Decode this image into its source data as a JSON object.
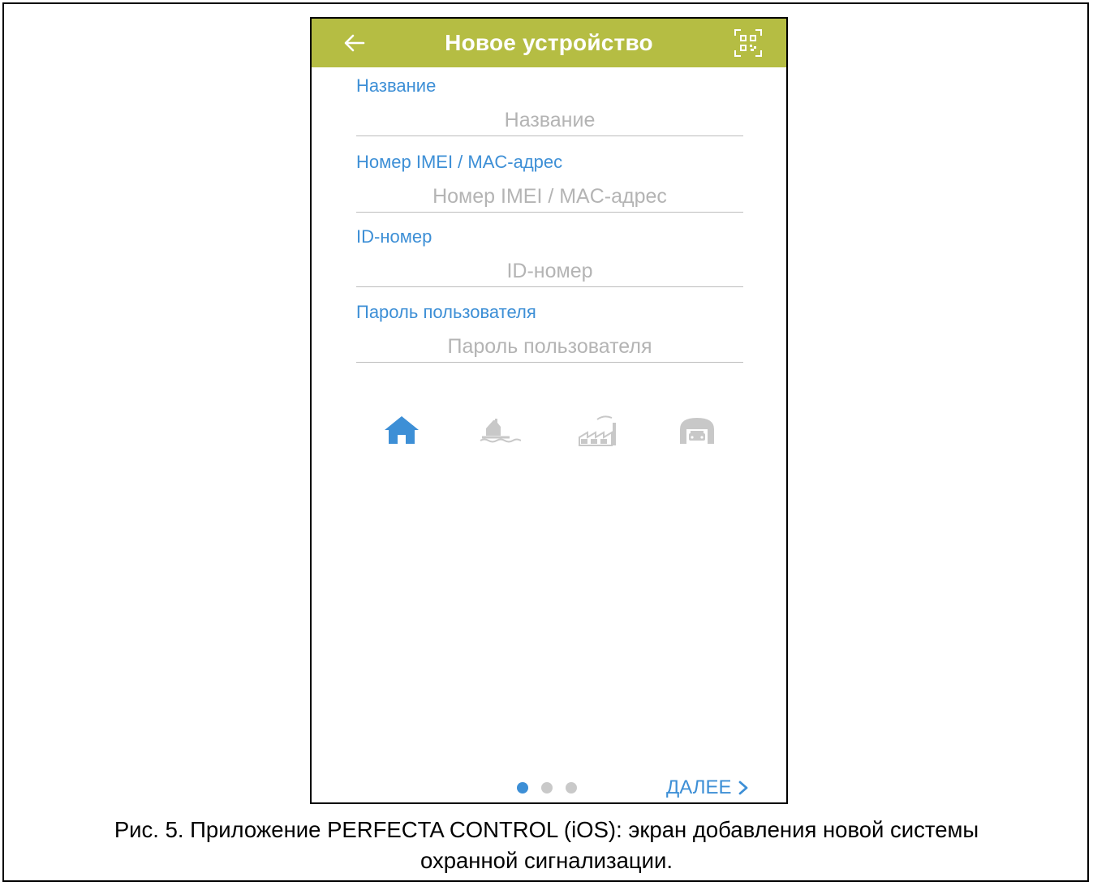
{
  "header": {
    "title": "Новое устройство",
    "back_icon": "arrow-left-icon",
    "qr_icon": "qr-code-scan-icon",
    "accent_color": "#b5bd43"
  },
  "form": {
    "fields": [
      {
        "label": "Название",
        "placeholder": "Название",
        "value": ""
      },
      {
        "label": "Номер IMEI / MAC-адрес",
        "placeholder": "Номер IMEI / MAC-адрес",
        "value": ""
      },
      {
        "label": "ID-номер",
        "placeholder": "ID-номер",
        "value": ""
      },
      {
        "label": "Пароль пользователя",
        "placeholder": "Пароль пользователя",
        "value": ""
      }
    ],
    "label_color": "#3d8fd6"
  },
  "object_types": {
    "selected": "home-icon",
    "icons": [
      "home-icon",
      "lake-house-icon",
      "factory-icon",
      "garage-icon"
    ],
    "active_color": "#3d8fd6",
    "inactive_color": "#c8c8c8"
  },
  "pager": {
    "total": 3,
    "current": 1,
    "next_label": "ДАЛЕЕ",
    "next_icon": "chevron-right-icon"
  },
  "caption": {
    "line1": "Рис. 5. Приложение PERFECTA CONTROL (iOS): экран добавления новой системы",
    "line2": "охранной сигнализации."
  }
}
